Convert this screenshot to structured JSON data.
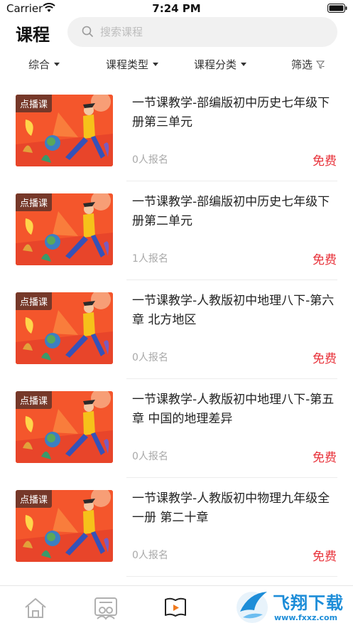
{
  "status_bar": {
    "carrier": "Carrier",
    "time": "7:24 PM"
  },
  "header": {
    "title": "课程",
    "search_placeholder": "搜索课程"
  },
  "filters": [
    {
      "label": "综合",
      "icon": "caret-down-icon"
    },
    {
      "label": "课程类型",
      "icon": "caret-down-icon"
    },
    {
      "label": "课程分类",
      "icon": "caret-down-icon"
    },
    {
      "label": "筛选",
      "icon": "funnel-icon"
    }
  ],
  "courses": [
    {
      "badge": "点播课",
      "title": "一节课教学-部编版初中历史七年级下册第三单元",
      "enroll": "0人报名",
      "price": "免费"
    },
    {
      "badge": "点播课",
      "title": "一节课教学-部编版初中历史七年级下册第二单元",
      "enroll": "1人报名",
      "price": "免费"
    },
    {
      "badge": "点播课",
      "title": "一节课教学-人教版初中地理八下-第六章 北方地区",
      "enroll": "0人报名",
      "price": "免费"
    },
    {
      "badge": "点播课",
      "title": "一节课教学-人教版初中地理八下-第五章 中国的地理差异",
      "enroll": "0人报名",
      "price": "免费"
    },
    {
      "badge": "点播课",
      "title": "一节课教学-人教版初中物理九年级全一册 第二十章",
      "enroll": "0人报名",
      "price": "免费"
    }
  ],
  "tab_bar": {
    "tabs": [
      {
        "icon": "home-icon"
      },
      {
        "icon": "community-icon"
      },
      {
        "icon": "course-play-icon",
        "active": true
      }
    ],
    "watermark_text": "飞翔下载",
    "watermark_url": "www.fxxz.com"
  },
  "colors": {
    "price": "#e8323a",
    "accent_active": "#f07a1e",
    "thumb_bg": "#f4562c"
  }
}
